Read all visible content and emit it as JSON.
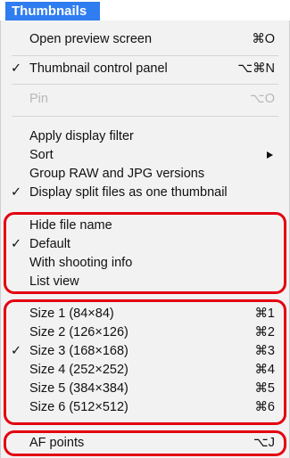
{
  "menu_title": "Thumbnails",
  "colors": {
    "accent": "#2f7df0",
    "highlight": "#e3000f"
  },
  "items": [
    {
      "label": "Open preview screen",
      "shortcut": "⌘O",
      "check": ""
    },
    {
      "label": "Thumbnail control panel",
      "shortcut": "⌥⌘N",
      "check": "✓"
    },
    {
      "label": "Pin",
      "shortcut": "⌥O",
      "check": "",
      "disabled": true
    },
    {
      "label": "Apply display filter",
      "shortcut": "",
      "check": ""
    },
    {
      "label": "Sort",
      "shortcut": "",
      "check": "",
      "submenu": true
    },
    {
      "label": "Group RAW and JPG versions",
      "shortcut": "",
      "check": ""
    },
    {
      "label": "Display split files as one thumbnail",
      "shortcut": "",
      "check": "✓"
    },
    {
      "label": "Hide file name",
      "shortcut": "",
      "check": ""
    },
    {
      "label": "Default",
      "shortcut": "",
      "check": "✓"
    },
    {
      "label": "With shooting info",
      "shortcut": "",
      "check": ""
    },
    {
      "label": "List view",
      "shortcut": "",
      "check": ""
    },
    {
      "label": "Size 1 (84×84)",
      "shortcut": "⌘1",
      "check": ""
    },
    {
      "label": "Size 2 (126×126)",
      "shortcut": "⌘2",
      "check": ""
    },
    {
      "label": "Size 3 (168×168)",
      "shortcut": "⌘3",
      "check": "✓"
    },
    {
      "label": "Size 4 (252×252)",
      "shortcut": "⌘4",
      "check": ""
    },
    {
      "label": "Size 5 (384×384)",
      "shortcut": "⌘5",
      "check": ""
    },
    {
      "label": "Size 6 (512×512)",
      "shortcut": "⌘6",
      "check": ""
    },
    {
      "label": "AF points",
      "shortcut": "⌥J",
      "check": ""
    }
  ]
}
